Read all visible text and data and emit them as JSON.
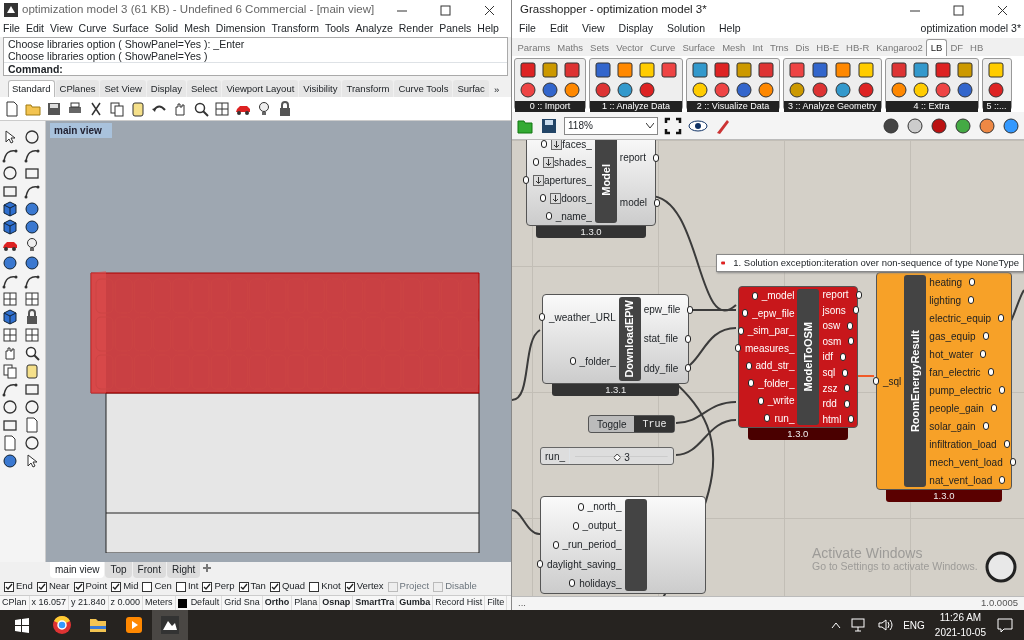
{
  "rhino": {
    "title": "optimization model 3 (61 KB) - Undefined 6 Commercial - [main view]",
    "menu": [
      "File",
      "Edit",
      "View",
      "Curve",
      "Surface",
      "Solid",
      "Mesh",
      "Dimension",
      "Transform",
      "Tools",
      "Analyze",
      "Render",
      "Panels",
      "Help"
    ],
    "command_history": [
      "Choose libraries option ( ShowPanel=Yes ): _Enter",
      "Choose libraries option ( ShowPanel=Yes )"
    ],
    "command_prompt": "Command:",
    "toolbar_tabs": [
      {
        "label": "Standard",
        "selected": true
      },
      {
        "label": "CPlanes",
        "selected": false
      },
      {
        "label": "Set View",
        "selected": false
      },
      {
        "label": "Display",
        "selected": false
      },
      {
        "label": "Select",
        "selected": false
      },
      {
        "label": "Viewport Layout",
        "selected": false
      },
      {
        "label": "Visibility",
        "selected": false
      },
      {
        "label": "Transform",
        "selected": false
      },
      {
        "label": "Curve Tools",
        "selected": false
      },
      {
        "label": "Surfac",
        "selected": false
      }
    ],
    "toolbar_more": "»",
    "viewport": {
      "title": "main view"
    },
    "viewport_tabs": [
      {
        "label": "main view",
        "selected": true
      },
      {
        "label": "Top",
        "selected": false
      },
      {
        "label": "Front",
        "selected": false
      },
      {
        "label": "Right",
        "selected": false
      }
    ],
    "osnaps": [
      {
        "label": "End",
        "checked": true,
        "disabled": false
      },
      {
        "label": "Near",
        "checked": true,
        "disabled": false
      },
      {
        "label": "Point",
        "checked": true,
        "disabled": false
      },
      {
        "label": "Mid",
        "checked": true,
        "disabled": false
      },
      {
        "label": "Cen",
        "checked": false,
        "disabled": false
      },
      {
        "label": "Int",
        "checked": false,
        "disabled": false
      },
      {
        "label": "Perp",
        "checked": true,
        "disabled": false
      },
      {
        "label": "Tan",
        "checked": true,
        "disabled": false
      },
      {
        "label": "Quad",
        "checked": true,
        "disabled": false
      },
      {
        "label": "Knot",
        "checked": false,
        "disabled": false
      },
      {
        "label": "Vertex",
        "checked": true,
        "disabled": false
      },
      {
        "label": "Project",
        "checked": false,
        "disabled": true
      },
      {
        "label": "Disable",
        "checked": false,
        "disabled": true
      }
    ],
    "status_bar": [
      {
        "text": "CPlan",
        "on": false
      },
      {
        "text": "x 16.057",
        "on": false
      },
      {
        "text": "y 21.840",
        "on": false
      },
      {
        "text": "z 0.000",
        "on": false
      },
      {
        "text": "Meters",
        "on": false
      },
      {
        "text": "Default",
        "on": false,
        "kind": "layer"
      },
      {
        "text": "Grid Sna",
        "on": false
      },
      {
        "text": "Ortho",
        "on": true
      },
      {
        "text": "Plana",
        "on": false
      },
      {
        "text": "Osnap",
        "on": true
      },
      {
        "text": "SmartTra",
        "on": true
      },
      {
        "text": "Gumba",
        "on": true
      },
      {
        "text": "Record Hist",
        "on": false
      },
      {
        "text": "Filte",
        "on": false
      }
    ]
  },
  "grasshopper": {
    "title": "Grasshopper - optimization model 3*",
    "menu": [
      "File",
      "Edit",
      "View",
      "Display",
      "Solution",
      "Help"
    ],
    "document_name": "optimization model 3*",
    "tabs": [
      {
        "label": "Params",
        "selected": false
      },
      {
        "label": "Maths",
        "selected": false
      },
      {
        "label": "Sets",
        "selected": false
      },
      {
        "label": "Vector",
        "selected": false
      },
      {
        "label": "Curve",
        "selected": false
      },
      {
        "label": "Surface",
        "selected": false
      },
      {
        "label": "Mesh",
        "selected": false
      },
      {
        "label": "Int",
        "selected": false
      },
      {
        "label": "Trns",
        "selected": false
      },
      {
        "label": "Dis",
        "selected": false
      },
      {
        "label": "HB-E",
        "selected": false
      },
      {
        "label": "HB-R",
        "selected": false
      },
      {
        "label": "Kangaroo2",
        "selected": false
      },
      {
        "label": "LB",
        "selected": true
      },
      {
        "label": "DF",
        "selected": false
      },
      {
        "label": "HB",
        "selected": false
      }
    ],
    "panels": [
      {
        "label": "0 :: Import"
      },
      {
        "label": "1 :: Analyze Data"
      },
      {
        "label": "2 :: Visualize Data"
      },
      {
        "label": "3 :: Analyze Geometry"
      },
      {
        "label": "4 :: Extra"
      },
      {
        "label": "5 ::..."
      }
    ],
    "zoom": "118%",
    "components": [
      {
        "title": "Model",
        "kind": "normal",
        "version": "1.3.0",
        "inputs": [
          "faces_",
          "shades_",
          "apertures_",
          "doors_",
          "_name_"
        ],
        "outputs": [
          "report",
          "model"
        ]
      },
      {
        "title": "DownloadEPW",
        "kind": "normal",
        "version": "1.3.1",
        "inputs": [
          "_weather_URL",
          "_folder_"
        ],
        "outputs": [
          "epw_file",
          "stat_file",
          "ddy_file"
        ]
      },
      {
        "title": "ModelToOSM",
        "kind": "error",
        "version": "1.3.0",
        "inputs": [
          "_model",
          "_epw_file",
          "_sim_par_",
          "measures_",
          "add_str_",
          "_folder_",
          "_write",
          "run_"
        ],
        "outputs": [
          "report",
          "jsons",
          "osw",
          "osm",
          "idf",
          "sql",
          "zsz",
          "rdd",
          "html"
        ]
      },
      {
        "title": "RoomEnergyResult",
        "kind": "warning",
        "version": "1.3.0",
        "inputs": [
          "_sql"
        ],
        "outputs": [
          "heating",
          "lighting",
          "electric_equip",
          "gas_equip",
          "hot_water",
          "fan_electric",
          "pump_electric",
          "people_gain",
          "solar_gain",
          "infiltration_load",
          "mech_vent_load",
          "nat_vent_load"
        ]
      },
      {
        "kind": "normal",
        "inputs": [
          "_north_",
          "_output_",
          "_run_period_",
          "daylight_saving_",
          "holidays_"
        ]
      }
    ],
    "toggle": {
      "label": "Toggle",
      "value": "True",
      "on": true
    },
    "slider": {
      "label": "run_",
      "value": "3",
      "level": 0.5
    },
    "error_message": "1. Solution exception:iteration over non-sequence of type NoneType",
    "activation_notice": {
      "title": "Activate Windows",
      "text": "Go to Settings to activate Windows."
    },
    "status_left": "...",
    "version": "1.0.0005"
  },
  "taskbar": {
    "language": "ENG",
    "time": "11:26 AM",
    "date": "2021-10-05"
  }
}
